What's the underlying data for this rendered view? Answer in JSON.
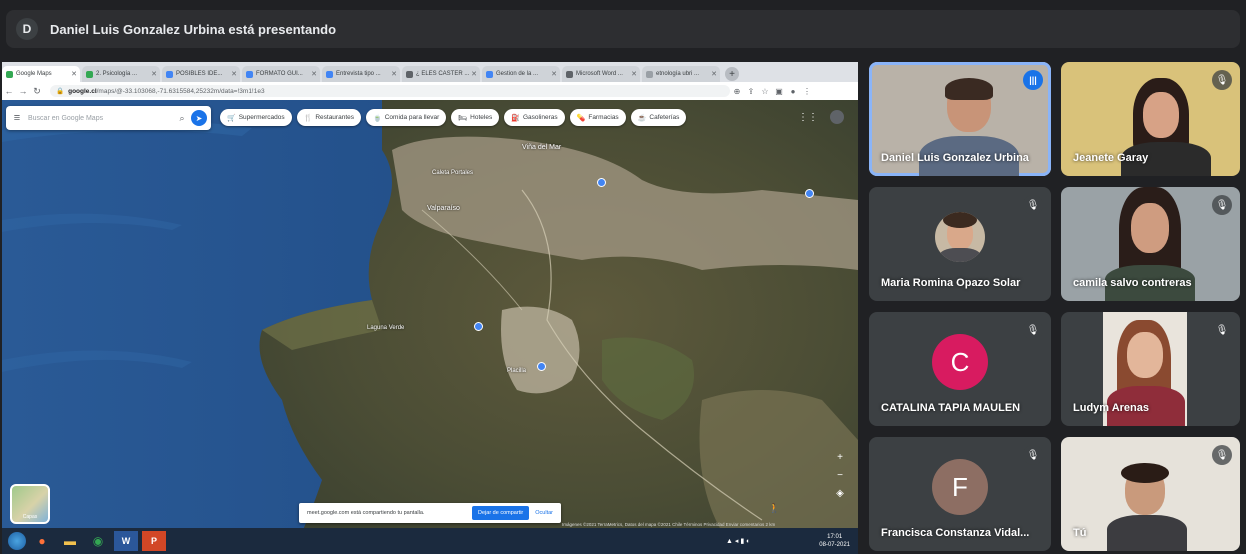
{
  "presenting": {
    "avatar_letter": "D",
    "text": "Daniel Luis Gonzalez Urbina está presentando"
  },
  "browser": {
    "tabs": [
      {
        "label": "Google Maps",
        "color": "#34a853",
        "active": true
      },
      {
        "label": "2. Psicología ...",
        "color": "#34a853"
      },
      {
        "label": "POSIBLES IDE...",
        "color": "#4285f4"
      },
      {
        "label": "FORMATO GUI...",
        "color": "#4285f4"
      },
      {
        "label": "Entrevista tipo ...",
        "color": "#4285f4"
      },
      {
        "label": "¿ ELES CASTER ...",
        "color": "#5f6368"
      },
      {
        "label": "Gestion de la ...",
        "color": "#4285f4"
      },
      {
        "label": "Microsoft Word ...",
        "color": "#5f6368"
      },
      {
        "label": "etnología ubri ...",
        "color": "#9aa0a6"
      }
    ],
    "url_host": "google.cl",
    "url_path": "/maps/@-33.103068,-71.6315584,25232m/data=!3m1!1e3"
  },
  "map": {
    "search_placeholder": "Buscar en Google Maps",
    "chips": [
      {
        "icon": "🛒",
        "label": "Supermercados"
      },
      {
        "icon": "🍴",
        "label": "Restaurantes"
      },
      {
        "icon": "🍵",
        "label": "Comida para llevar"
      },
      {
        "icon": "🛏",
        "label": "Hoteles"
      },
      {
        "icon": "⛽",
        "label": "Gasolineras"
      },
      {
        "icon": "💊",
        "label": "Farmacias"
      },
      {
        "icon": "☕",
        "label": "Cafeterías"
      }
    ],
    "places": {
      "vina": "Viña del Mar",
      "caleta": "Caleta Portales",
      "valparaiso": "Valparaíso",
      "placilla": "Placilla",
      "laguna": "Laguna Verde"
    },
    "layers_label": "Capas",
    "share_text": "meet.google.com está compartiendo tu pantalla.",
    "share_stop": "Dejar de compartir",
    "share_hide": "Ocultar",
    "footer": "Imágenes ©2021 TerraMetrics, Datos del mapa ©2021   Chile   Términos   Privacidad   Enviar comentarios   2 km"
  },
  "taskbar": {
    "time": "17:01",
    "date": "08-07-2021"
  },
  "participants": [
    {
      "name": "Daniel Luis Gonzalez Urbina",
      "speaking": true
    },
    {
      "name": "Jeanete Garay",
      "muted": true
    },
    {
      "name": "Maria Romina Opazo Solar",
      "muted": true
    },
    {
      "name": "camila salvo contreras",
      "muted": true
    },
    {
      "name": "CATALINA TAPIA MAULEN",
      "muted": true,
      "letter": "C",
      "color": "#d81b60"
    },
    {
      "name": "Ludym Arenas",
      "muted": true
    },
    {
      "name": "Francisca Constanza Vidal...",
      "muted": true,
      "letter": "F",
      "color": "#8d6e63"
    },
    {
      "name": "Tú",
      "muted": true
    }
  ]
}
